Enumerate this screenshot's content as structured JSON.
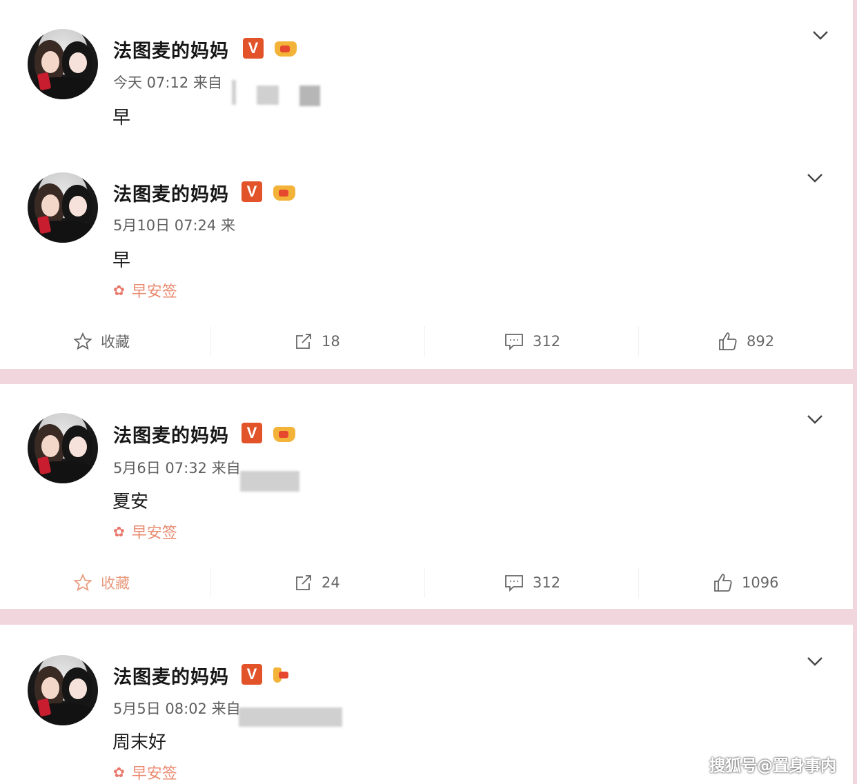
{
  "author": "法图麦的妈妈",
  "badge_letter": "V",
  "posts": [
    {
      "time": "今天 07:12 来自",
      "text": "早",
      "topic": "",
      "share": "",
      "comments": "",
      "likes": ""
    },
    {
      "time": "5月10日 07:24 来",
      "text": "早",
      "topic": "早安签",
      "collect": "收藏",
      "share": "18",
      "comments": "312",
      "likes": "892"
    },
    {
      "time": "5月6日 07:32 来自",
      "text": "夏安",
      "topic": "早安签",
      "collect": "收藏",
      "share": "24",
      "comments": "312",
      "likes": "1096"
    },
    {
      "time": "5月5日 08:02 来自",
      "text": "周末好",
      "topic": "早安签"
    }
  ],
  "watermark": "搜狐号@置身事内",
  "colors": {
    "accent": "#e2532a",
    "topic": "#ea8a6f",
    "separator": "#f2d6dd"
  },
  "icons": [
    "chevron-down-icon",
    "star-icon",
    "share-icon",
    "comment-icon",
    "thumbs-up-icon",
    "flower-icon",
    "verified-badge-icon",
    "crown-icon"
  ]
}
